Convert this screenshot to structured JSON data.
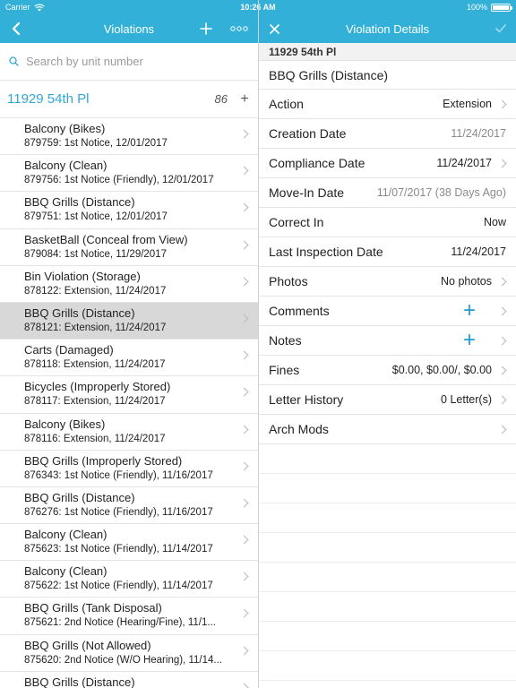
{
  "status": {
    "carrier": "Carrier",
    "time": "10:26 AM",
    "battery": "100%",
    "battery_level": 1.0
  },
  "left_nav": {
    "title": "Violations",
    "back_icon": "chevron-left-icon",
    "add_icon": "plus-icon",
    "more_icon": "more-icon"
  },
  "right_nav": {
    "title": "Violation Details",
    "close_icon": "close-icon",
    "confirm_icon": "checkmark-icon"
  },
  "search": {
    "placeholder": "Search by unit number",
    "value": ""
  },
  "group": {
    "title": "11929 54th Pl",
    "count": "86",
    "add": "+"
  },
  "violations": [
    {
      "title": "Balcony (Bikes)",
      "subtitle": "879759: 1st Notice, 12/01/2017"
    },
    {
      "title": "Balcony (Clean)",
      "subtitle": "879756: 1st Notice (Friendly), 12/01/2017"
    },
    {
      "title": "BBQ Grills (Distance)",
      "subtitle": "879751: 1st Notice, 12/01/2017"
    },
    {
      "title": "BasketBall (Conceal from View)",
      "subtitle": "879084: 1st Notice, 11/29/2017"
    },
    {
      "title": "Bin Violation (Storage)",
      "subtitle": "878122: Extension, 11/24/2017"
    },
    {
      "title": "BBQ Grills (Distance)",
      "subtitle": "878121: Extension, 11/24/2017",
      "selected": true
    },
    {
      "title": "Carts (Damaged)",
      "subtitle": "878118: Extension, 11/24/2017"
    },
    {
      "title": "Bicycles (Improperly Stored)",
      "subtitle": "878117: Extension, 11/24/2017"
    },
    {
      "title": "Balcony (Bikes)",
      "subtitle": "878116: Extension, 11/24/2017"
    },
    {
      "title": "BBQ Grills (Improperly Stored)",
      "subtitle": "876343: 1st Notice (Friendly), 11/16/2017"
    },
    {
      "title": "BBQ Grills (Distance)",
      "subtitle": "876276: 1st Notice (Friendly), 11/16/2017"
    },
    {
      "title": "Balcony (Clean)",
      "subtitle": "875623: 1st Notice (Friendly), 11/14/2017"
    },
    {
      "title": "Balcony (Clean)",
      "subtitle": "875622: 1st Notice (Friendly), 11/14/2017"
    },
    {
      "title": "BBQ Grills (Tank Disposal)",
      "subtitle": "875621: 2nd Notice (Hearing/Fine), 11/1..."
    },
    {
      "title": "BBQ Grills (Not Allowed)",
      "subtitle": "875620: 2nd Notice (W/O Hearing), 11/14..."
    },
    {
      "title": "BBQ Grills (Distance)",
      "subtitle": ""
    }
  ],
  "details": {
    "unit": "11929 54th Pl",
    "violation": "BBQ Grills (Distance)",
    "rows": [
      {
        "label": "Action",
        "value": "Extension",
        "muted": false,
        "chevron": true,
        "plus": false
      },
      {
        "label": "Creation Date",
        "value": "11/24/2017",
        "muted": true,
        "chevron": false,
        "plus": false
      },
      {
        "label": "Compliance Date",
        "value": "11/24/2017",
        "muted": false,
        "chevron": true,
        "plus": false
      },
      {
        "label": "Move-In Date",
        "value": "11/07/2017 (38 Days Ago)",
        "muted": true,
        "chevron": false,
        "plus": false
      },
      {
        "label": "Correct In",
        "value": "Now",
        "muted": false,
        "chevron": false,
        "plus": false
      },
      {
        "label": "Last Inspection Date",
        "value": "11/24/2017",
        "muted": false,
        "chevron": false,
        "plus": false
      },
      {
        "label": "Photos",
        "value": "No photos",
        "muted": false,
        "chevron": true,
        "plus": false
      },
      {
        "label": "Comments",
        "value": "+",
        "muted": false,
        "chevron": true,
        "plus": true
      },
      {
        "label": "Notes",
        "value": "+",
        "muted": false,
        "chevron": true,
        "plus": true
      },
      {
        "label": "Fines",
        "value": "$0.00, $0.00/, $0.00",
        "muted": false,
        "chevron": true,
        "plus": false
      },
      {
        "label": "Letter History",
        "value": "0 Letter(s)",
        "muted": false,
        "chevron": true,
        "plus": false
      },
      {
        "label": "Arch Mods",
        "value": "",
        "muted": false,
        "chevron": true,
        "plus": false
      }
    ]
  }
}
